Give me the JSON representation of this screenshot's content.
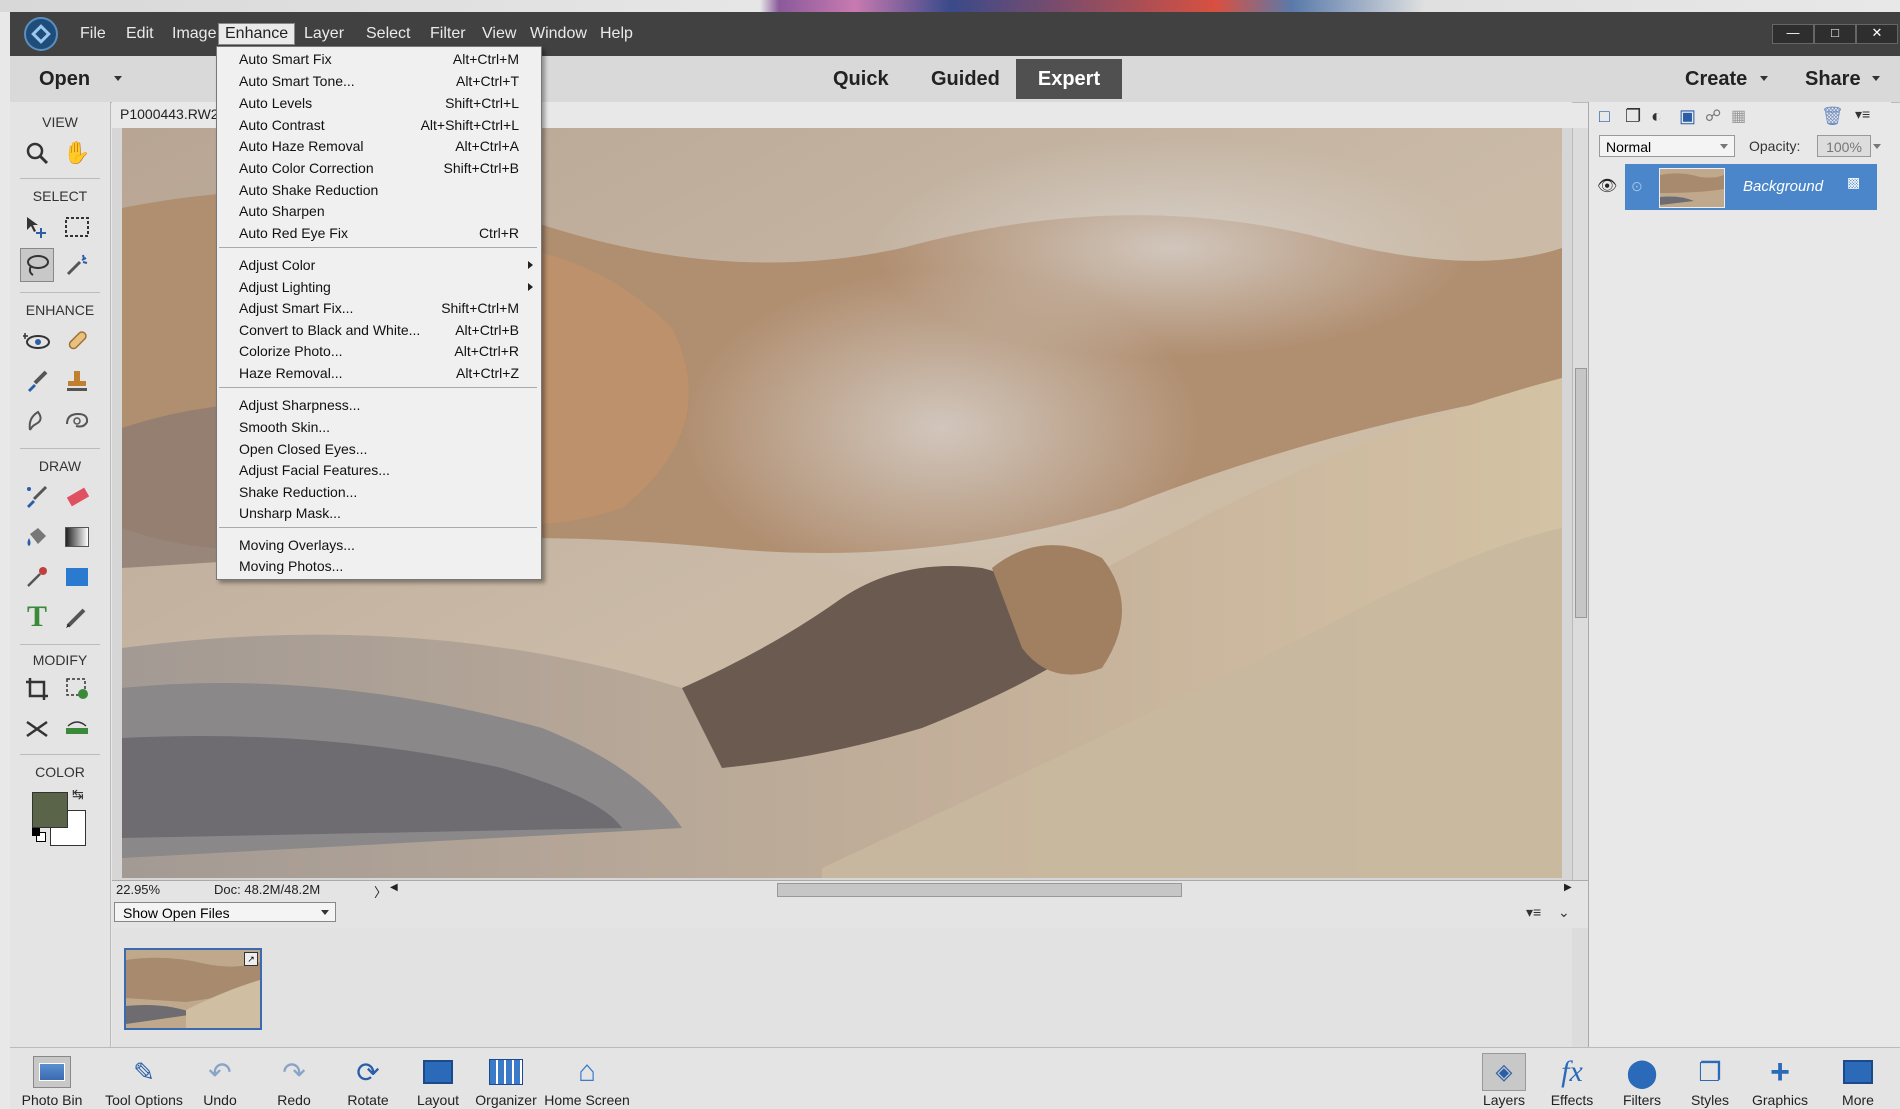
{
  "menubar": {
    "items": [
      "File",
      "Edit",
      "Image",
      "Enhance",
      "Layer",
      "Select",
      "Filter",
      "View",
      "Window",
      "Help"
    ],
    "active": "Enhance"
  },
  "modebar": {
    "open_label": "Open",
    "modes": [
      "Quick",
      "Guided",
      "Expert"
    ],
    "selected_mode": "Expert",
    "create_label": "Create",
    "share_label": "Share"
  },
  "toolbox": {
    "sections": [
      "VIEW",
      "SELECT",
      "ENHANCE",
      "DRAW",
      "MODIFY",
      "COLOR"
    ],
    "foreground_color": "#5a6448",
    "background_color": "#ffffff"
  },
  "document": {
    "tab_name": "P1000443.RW2",
    "zoom": "22.95%",
    "doc_size": "Doc: 48.2M/48.2M"
  },
  "enhance_menu": {
    "group1": [
      {
        "label": "Auto Smart Fix",
        "shortcut": "Alt+Ctrl+M"
      },
      {
        "label": "Auto Smart Tone...",
        "shortcut": "Alt+Ctrl+T"
      },
      {
        "label": "Auto Levels",
        "shortcut": "Shift+Ctrl+L"
      },
      {
        "label": "Auto Contrast",
        "shortcut": "Alt+Shift+Ctrl+L"
      },
      {
        "label": "Auto Haze Removal",
        "shortcut": "Alt+Ctrl+A"
      },
      {
        "label": "Auto Color Correction",
        "shortcut": "Shift+Ctrl+B"
      },
      {
        "label": "Auto Shake Reduction",
        "shortcut": ""
      },
      {
        "label": "Auto Sharpen",
        "shortcut": ""
      },
      {
        "label": "Auto Red Eye Fix",
        "shortcut": "Ctrl+R"
      }
    ],
    "group2": [
      {
        "label": "Adjust Color",
        "shortcut": "",
        "submenu": true
      },
      {
        "label": "Adjust Lighting",
        "shortcut": "",
        "submenu": true
      },
      {
        "label": "Adjust Smart Fix...",
        "shortcut": "Shift+Ctrl+M"
      },
      {
        "label": "Convert to Black and White...",
        "shortcut": "Alt+Ctrl+B"
      },
      {
        "label": "Colorize Photo...",
        "shortcut": "Alt+Ctrl+R"
      },
      {
        "label": "Haze Removal...",
        "shortcut": "Alt+Ctrl+Z"
      }
    ],
    "group3": [
      {
        "label": "Adjust Sharpness...",
        "shortcut": ""
      },
      {
        "label": "Smooth Skin...",
        "shortcut": ""
      },
      {
        "label": "Open Closed Eyes...",
        "shortcut": ""
      },
      {
        "label": "Adjust Facial Features...",
        "shortcut": ""
      },
      {
        "label": "Shake Reduction...",
        "shortcut": ""
      },
      {
        "label": "Unsharp Mask...",
        "shortcut": ""
      }
    ],
    "group4": [
      {
        "label": "Moving Overlays...",
        "shortcut": ""
      },
      {
        "label": "Moving Photos...",
        "shortcut": ""
      }
    ]
  },
  "layers_panel": {
    "blend_mode": "Normal",
    "opacity_label": "Opacity:",
    "opacity_value": "100%",
    "layer_name": "Background",
    "selected_color": "#4a86c9"
  },
  "photo_bin": {
    "dropdown_label": "Show Open Files"
  },
  "taskbar": {
    "left": [
      "Photo Bin",
      "Tool Options",
      "Undo",
      "Redo",
      "Rotate",
      "Layout",
      "Organizer",
      "Home Screen"
    ],
    "right": [
      "Layers",
      "Effects",
      "Filters",
      "Styles",
      "Graphics",
      "More"
    ]
  }
}
